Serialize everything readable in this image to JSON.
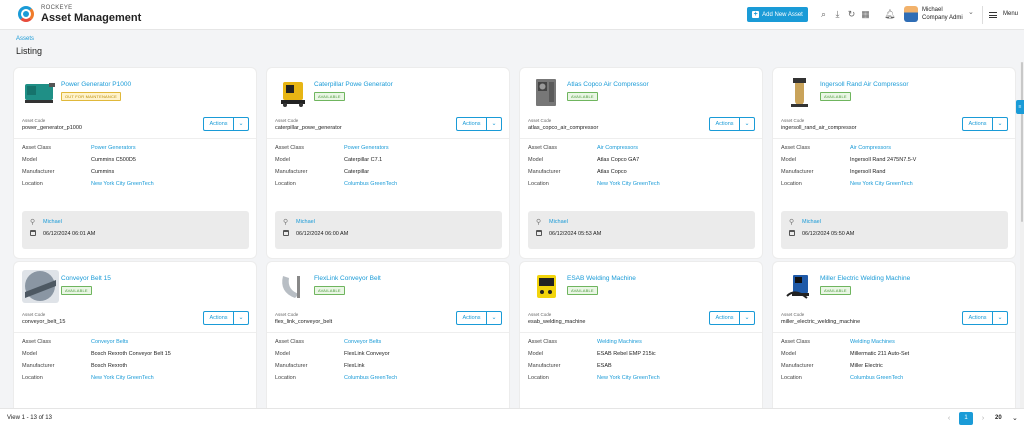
{
  "header": {
    "brand_small": "ROCKEYE",
    "brand_title": "Asset Management",
    "add_button": "Add New Asset",
    "user_name": "Michael",
    "user_role": "Company Admi",
    "menu_label": "Menu"
  },
  "breadcrumb": "Assets",
  "page_title": "Listing",
  "labels": {
    "asset_code": "Asset Code",
    "actions": "Actions",
    "asset_class": "Asset Class",
    "model": "Model",
    "manufacturer": "Manufacturer",
    "location": "Location"
  },
  "cards": [
    {
      "name": "Power Generator P1000",
      "status": "OUT FOR MAINTENANCE",
      "code": "power_generator_p1000",
      "asset_class": "Power Generators",
      "model": "Cummins C500D5",
      "manufacturer": "Cummins",
      "location": "New York City GreenTech",
      "user": "Michael",
      "date": "06/12/2024 06:01 AM"
    },
    {
      "name": "Caterpillar Powe Generator",
      "status": "AVAILABLE",
      "code": "caterpillar_powe_generator",
      "asset_class": "Power Generators",
      "model": "Caterpillar C7.1",
      "manufacturer": "Caterpillar",
      "location": "Columbus GreenTech",
      "user": "Michael",
      "date": "06/12/2024 06:00 AM"
    },
    {
      "name": "Atlas Copco Air Compressor",
      "status": "AVAILABLE",
      "code": "atlas_copco_air_compressor",
      "asset_class": "Air Compressors",
      "model": "Atlas Copco GA7",
      "manufacturer": "Atlas Copco",
      "location": "New York City GreenTech",
      "user": "Michael",
      "date": "06/12/2024 05:53 AM"
    },
    {
      "name": "Ingersoll Rand Air Compressor",
      "status": "AVAILABLE",
      "code": "ingersoll_rand_air_compressor",
      "asset_class": "Air Compressors",
      "model": "Ingersoll Rand 2475N7.5-V",
      "manufacturer": "Ingersoll Rand",
      "location": "New York City GreenTech",
      "user": "Michael",
      "date": "06/12/2024 05:50 AM"
    },
    {
      "name": "Conveyor Belt 15",
      "status": "AVAILABLE",
      "code": "conveyor_belt_15",
      "asset_class": "Conveyor Belts",
      "model": "Bosch Rexroth Conveyor Belt 15",
      "manufacturer": "Bosch Rexroth",
      "location": "New York City GreenTech"
    },
    {
      "name": "FlexLink Conveyor Belt",
      "status": "AVAILABLE",
      "code": "flex_link_conveyor_belt",
      "asset_class": "Conveyor Belts",
      "model": "FlexLink Conveyor",
      "manufacturer": "FlexLink",
      "location": "Columbus GreenTech"
    },
    {
      "name": "ESAB Welding Machine",
      "status": "AVAILABLE",
      "code": "esab_welding_machine",
      "asset_class": "Welding Machines",
      "model": "ESAB Rebel EMP 215ic",
      "manufacturer": "ESAB",
      "location": "New York City GreenTech"
    },
    {
      "name": "Miller Electric Welding Machine",
      "status": "AVAILABLE",
      "code": "miller_electric_welding_machine",
      "asset_class": "Welding Machines",
      "model": "Millermatic 211 Auto-Set",
      "manufacturer": "Miller Electric",
      "location": "Columbus GreenTech"
    }
  ],
  "footer": {
    "view_text": "View 1 - 13 of 13",
    "current_page": "1",
    "per_page": "20"
  },
  "colors": {
    "accent": "#1a9bd7",
    "available": "#4a9a3a",
    "maintenance": "#b88a00"
  }
}
